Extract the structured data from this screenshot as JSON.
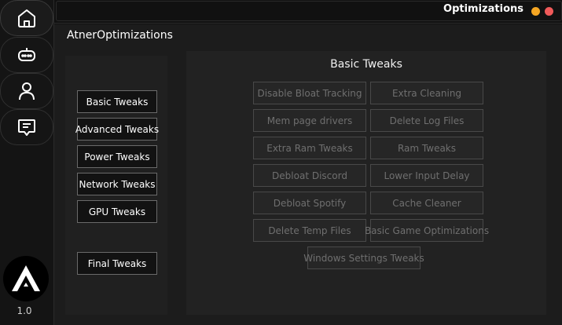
{
  "window": {
    "title": "Optimizations"
  },
  "app": {
    "title": "AtnerOptimizations",
    "version": "1.0"
  },
  "sidebar": {
    "icons": [
      {
        "name": "home-icon"
      },
      {
        "name": "gamepad-icon"
      },
      {
        "name": "user-icon"
      },
      {
        "name": "message-icon"
      }
    ]
  },
  "categories": {
    "basic": "Basic Tweaks",
    "advanced": "Advanced Tweaks",
    "power": "Power Tweaks",
    "network": "Network Tweaks",
    "gpu": "GPU Tweaks",
    "final": "Final Tweaks"
  },
  "section": {
    "title": "Basic Tweaks"
  },
  "tweaks": {
    "disable_bloat_tracking": "Disable Bloat Tracking",
    "extra_cleaning": "Extra Cleaning",
    "mem_page_drivers": "Mem page drivers",
    "delete_log_files": "Delete Log Files",
    "extra_ram_tweaks": "Extra Ram Tweaks",
    "ram_tweaks": "Ram Tweaks",
    "debloat_discord": "Debloat Discord",
    "lower_input_delay": "Lower Input Delay",
    "debloat_spotify": "Debloat Spotify",
    "cache_cleaner": "Cache Cleaner",
    "delete_temp_files": "Delete Temp Files",
    "basic_game_optimizations": "Basic Game Optimizations",
    "windows_settings_tweaks": "Windows Settings Tweaks"
  },
  "colors": {
    "background": "#121212",
    "panel": "#1c1c1c",
    "minimize_dot": "#f5a623",
    "close_dot": "#f05a5a",
    "disabled_text": "#6f6f6f"
  }
}
